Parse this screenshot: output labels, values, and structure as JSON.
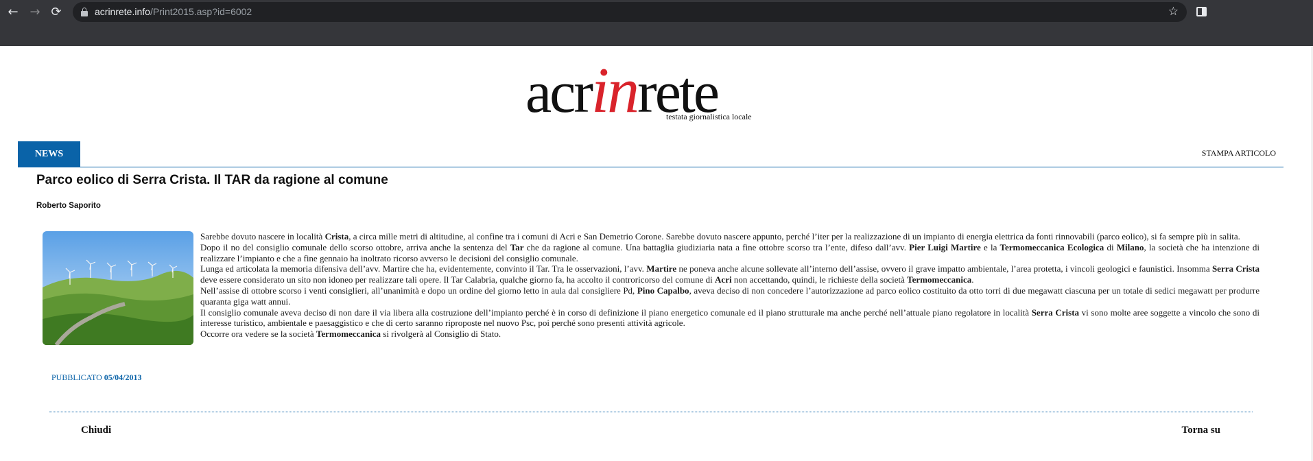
{
  "browser": {
    "url_domain": "acrinrete.info",
    "url_path": "/Print2015.asp?id=6002",
    "back_icon": "arrow-left-icon",
    "forward_icon": "arrow-right-icon",
    "reload_icon": "reload-icon",
    "lock_icon": "lock-icon",
    "bookmark_icon": "star-icon",
    "side_panel_icon": "side-panel-icon"
  },
  "site": {
    "logo_part1": "acr",
    "logo_part2": "in",
    "logo_part3": "rete",
    "logo_tagline": "testata giornalistica locale",
    "brand_red": "#d9232b",
    "accent_blue": "#0a63a8"
  },
  "tabs": {
    "section": "NEWS",
    "print": "STAMPA ARTICOLO"
  },
  "article": {
    "title": "Parco eolico di Serra Crista. Il TAR da ragione al comune",
    "author": "Roberto Saporito",
    "published_label": "PUBBLICATO",
    "published_date": "05/04/2013"
  },
  "footer": {
    "close": "Chiudi",
    "back_to_top": "Torna su"
  }
}
